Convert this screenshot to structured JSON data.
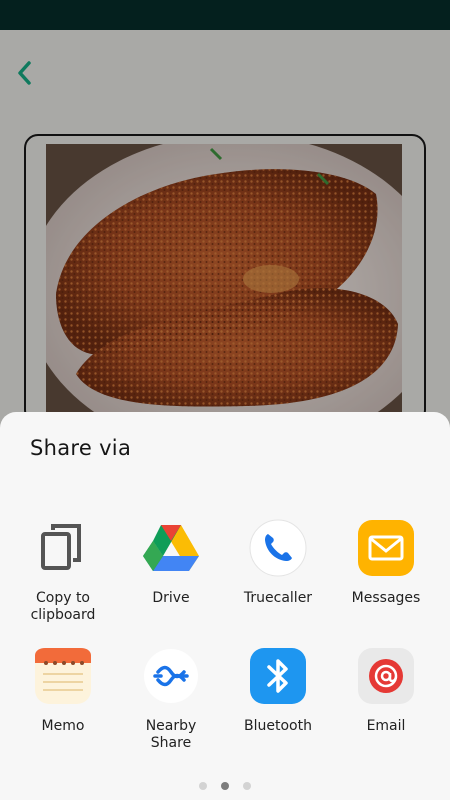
{
  "share_sheet": {
    "title": "Share via",
    "apps": [
      {
        "label": "Copy to\nclipboard",
        "icon": "copy-icon"
      },
      {
        "label": "Drive",
        "icon": "google-drive-icon"
      },
      {
        "label": "Truecaller",
        "icon": "phone-icon"
      },
      {
        "label": "Messages",
        "icon": "envelope-icon"
      },
      {
        "label": "Memo",
        "icon": "notepad-icon"
      },
      {
        "label": "Nearby\nShare",
        "icon": "nearby-share-icon"
      },
      {
        "label": "Bluetooth",
        "icon": "bluetooth-icon"
      },
      {
        "label": "Email",
        "icon": "at-sign-icon"
      }
    ],
    "pages": 3,
    "current_page": 2
  },
  "colors": {
    "status_bar": "#04201e",
    "accent": "#0f7a5e",
    "dimmed_background": "#a9a9a6",
    "sheet_background": "#f7f7f7"
  }
}
